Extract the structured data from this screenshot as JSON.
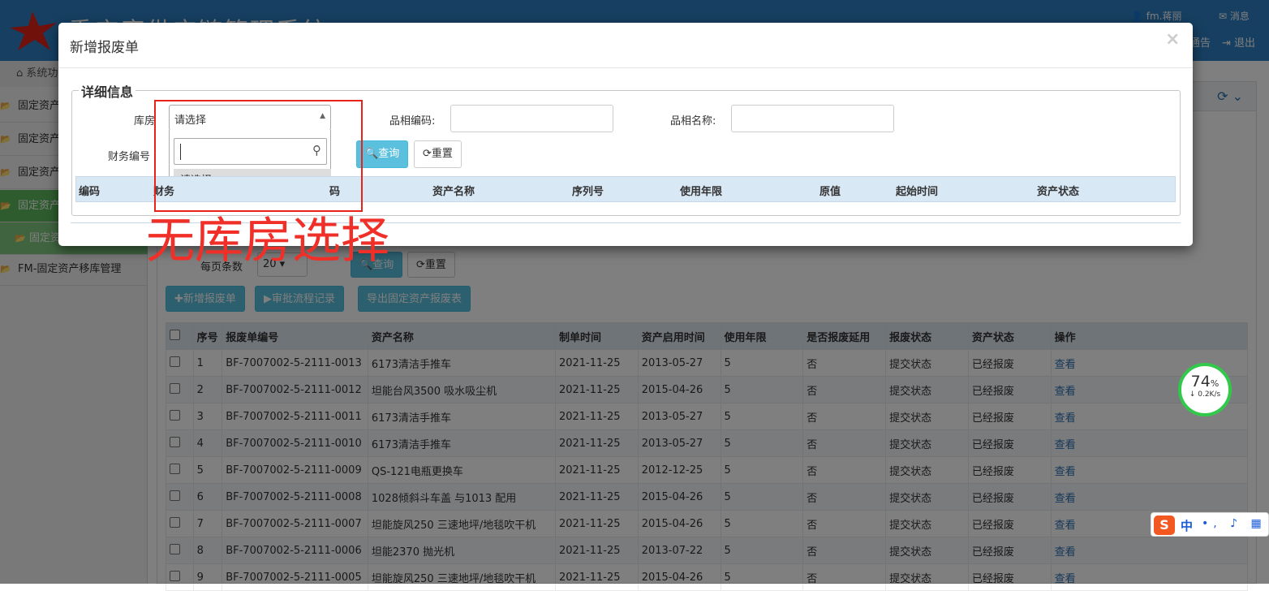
{
  "app": {
    "title": "重庆康供应链管理系统",
    "user": "fm.蒋丽",
    "messages_label": "消息",
    "notice_label": "通告",
    "logout_label": "退出"
  },
  "colors": {
    "topbar": "#2c7ec2",
    "sidebar_active": "#5cb85c",
    "annotation_red": "#e8231a",
    "info_button": "#5bc0de"
  },
  "sidebar": {
    "header": "系统功能",
    "items": [
      {
        "label": "固定资产",
        "icon": "folder-open-icon"
      },
      {
        "label": "固定资产",
        "icon": "folder-open-icon"
      },
      {
        "label": "固定资产",
        "icon": "folder-open-icon"
      },
      {
        "label": "固定资产",
        "icon": "folder-open-icon",
        "active": true
      },
      {
        "label": "固定资",
        "icon": "folder-open-icon",
        "sub": true
      },
      {
        "label": "FM-固定资产移库管理",
        "icon": "folder-open-icon"
      }
    ]
  },
  "page": {
    "per_page_label": "每页条数",
    "per_page_value": "20",
    "query_label": "查询",
    "reset_label": "重置",
    "toolbar": {
      "new_label": "新增报废单",
      "flow_label": "审批流程记录",
      "export_label": "导出固定资产报废表"
    }
  },
  "grid": {
    "columns": [
      "",
      "序号",
      "报废单编号",
      "资产名称",
      "制单时间",
      "资产启用时间",
      "使用年限",
      "是否报废延用",
      "报废状态",
      "资产状态",
      "操作"
    ],
    "rows": [
      [
        "1",
        "BF-7007002-5-2111-0013",
        "6173清洁手推车",
        "2021-11-25",
        "2013-05-27",
        "5",
        "否",
        "提交状态",
        "已经报废",
        "查看"
      ],
      [
        "2",
        "BF-7007002-5-2111-0012",
        "坦能台风3500 吸水吸尘机",
        "2021-11-25",
        "2015-04-26",
        "5",
        "否",
        "提交状态",
        "已经报废",
        "查看"
      ],
      [
        "3",
        "BF-7007002-5-2111-0011",
        "6173清洁手推车",
        "2021-11-25",
        "2013-05-27",
        "5",
        "否",
        "提交状态",
        "已经报废",
        "查看"
      ],
      [
        "4",
        "BF-7007002-5-2111-0010",
        "6173清洁手推车",
        "2021-11-25",
        "2013-05-27",
        "5",
        "否",
        "提交状态",
        "已经报废",
        "查看"
      ],
      [
        "5",
        "BF-7007002-5-2111-0009",
        "QS-121电瓶更换车",
        "2021-11-25",
        "2012-12-25",
        "5",
        "否",
        "提交状态",
        "已经报废",
        "查看"
      ],
      [
        "6",
        "BF-7007002-5-2111-0008",
        "1028倾斜斗车盖 与1013 配用",
        "2021-11-25",
        "2015-04-26",
        "5",
        "否",
        "提交状态",
        "已经报废",
        "查看"
      ],
      [
        "7",
        "BF-7007002-5-2111-0007",
        "坦能旋风250 三速地坪/地毯吹干机",
        "2021-11-25",
        "2015-04-26",
        "5",
        "否",
        "提交状态",
        "已经报废",
        "查看"
      ],
      [
        "8",
        "BF-7007002-5-2111-0006",
        "坦能2370 抛光机",
        "2021-11-25",
        "2013-07-22",
        "5",
        "否",
        "提交状态",
        "已经报废",
        "查看"
      ],
      [
        "9",
        "BF-7007002-5-2111-0005",
        "坦能旋风250 三速地坪/地毯吹干机",
        "2021-11-25",
        "2015-04-26",
        "5",
        "否",
        "提交状态",
        "已经报废",
        "查看"
      ]
    ]
  },
  "speed_widget": {
    "percent": "74",
    "percent_sign": "%",
    "rate": "0.2K/s"
  },
  "ime": {
    "logo": "S",
    "mode": "中",
    "rest": "•, ♪ ▦ ✦"
  },
  "modal": {
    "title": "新增报废单",
    "close": "×",
    "section_title": "详细信息",
    "labels": {
      "warehouse": "库房",
      "item_code": "品相编码:",
      "item_name": "品相名称:",
      "finance_no": "财务编号"
    },
    "warehouse_select": {
      "value": "请选择",
      "search_placeholder": "",
      "options": [
        "请选择"
      ]
    },
    "query_label": "查询",
    "reset_label": "重置",
    "table_headers": [
      "编码",
      "财务",
      "码",
      "资产名称",
      "序列号",
      "使用年限",
      "原值",
      "起始时间",
      "资产状态"
    ]
  },
  "annotation": {
    "text": "无库房选择"
  }
}
